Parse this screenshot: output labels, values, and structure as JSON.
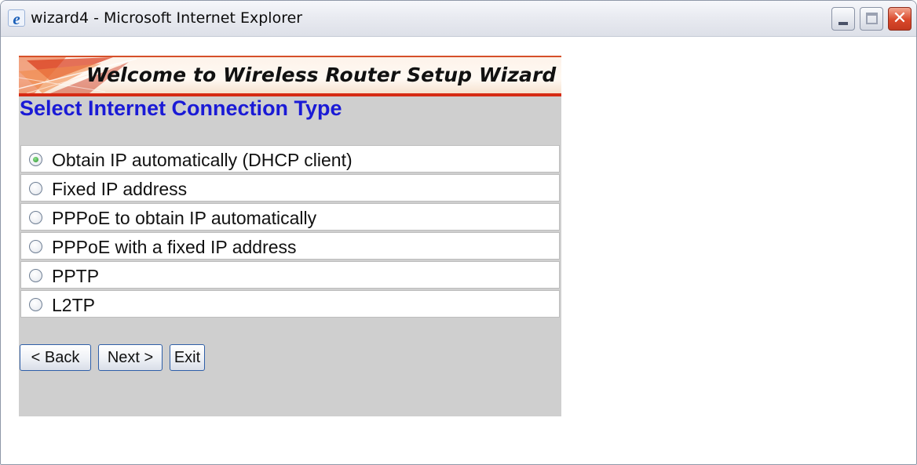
{
  "window": {
    "title": "wizard4 - Microsoft Internet Explorer",
    "app_icon": "internet-explorer-icon",
    "controls": {
      "minimize": "minimize-icon",
      "maximize": "maximize-icon",
      "close": "close-icon"
    },
    "colors": {
      "close_button": "#d9472a"
    }
  },
  "banner": {
    "title": "Welcome to Wireless Router Setup Wizard",
    "accent_color": "#d62b14"
  },
  "page": {
    "heading": "Select Internet Connection Type",
    "heading_color": "#1a1ad6",
    "background_color": "#cfcfcf"
  },
  "connection_options": [
    {
      "label": "Obtain IP automatically (DHCP client)",
      "selected": true
    },
    {
      "label": "Fixed IP address",
      "selected": false
    },
    {
      "label": "PPPoE to obtain IP automatically",
      "selected": false
    },
    {
      "label": "PPPoE with a fixed IP address",
      "selected": false
    },
    {
      "label": "PPTP",
      "selected": false
    },
    {
      "label": "L2TP",
      "selected": false
    }
  ],
  "buttons": {
    "back": "< Back",
    "next": "Next >",
    "exit": "Exit"
  }
}
